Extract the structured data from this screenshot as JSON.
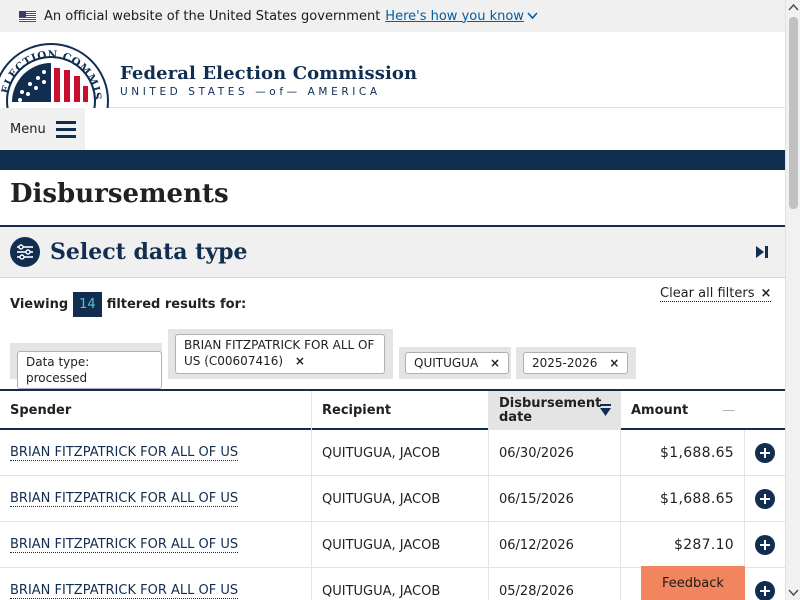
{
  "banner": {
    "text": "An official website of the United States government",
    "link": "Here's how you know"
  },
  "header": {
    "title": "Federal Election Commission",
    "subtitle": "UNITED STATES —of— AMERICA",
    "seal_text": "ELECTION COMMISSION"
  },
  "menu": {
    "label": "Menu"
  },
  "page": {
    "title": "Disbursements"
  },
  "datatype": {
    "label": "Select data type"
  },
  "results": {
    "viewing_label": "Viewing",
    "count": "14",
    "suffix": "filtered results for:",
    "clear_label": "Clear all filters",
    "clear_x": "×"
  },
  "filters": [
    {
      "label": "Data type: processed"
    },
    {
      "label": "BRIAN FITZPATRICK FOR ALL OF US (C00607416)",
      "x": "×"
    },
    {
      "label": "QUITUGUA",
      "x": "×"
    },
    {
      "label": "2025-2026",
      "x": "×"
    }
  ],
  "table": {
    "columns": [
      "Spender",
      "Recipient",
      "Disbursement date",
      "Amount"
    ],
    "amount_sort_symbol": "—",
    "rows": [
      {
        "spender": "BRIAN FITZPATRICK FOR ALL OF US",
        "recipient": "QUITUGUA, JACOB",
        "date": "06/30/2026",
        "amount": "$1,688.65"
      },
      {
        "spender": "BRIAN FITZPATRICK FOR ALL OF US",
        "recipient": "QUITUGUA, JACOB",
        "date": "06/15/2026",
        "amount": "$1,688.65"
      },
      {
        "spender": "BRIAN FITZPATRICK FOR ALL OF US",
        "recipient": "QUITUGUA, JACOB",
        "date": "06/12/2026",
        "amount": "$287.10"
      },
      {
        "spender": "BRIAN FITZPATRICK FOR ALL OF US",
        "recipient": "QUITUGUA, JACOB",
        "date": "05/28/2026",
        "amount": ""
      }
    ]
  },
  "feedback": {
    "label": "Feedback"
  },
  "colors": {
    "navy": "#112e51",
    "accent": "#f2845e",
    "link": "#005ea2",
    "count_text": "#5dc0d1"
  }
}
